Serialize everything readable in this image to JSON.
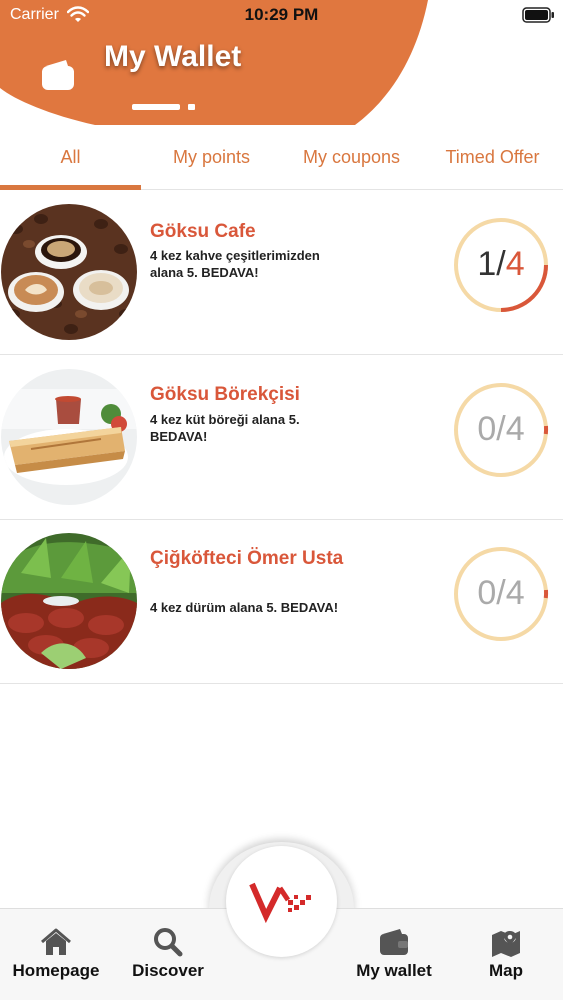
{
  "status_bar": {
    "carrier": "Carrier",
    "time": "10:29 PM"
  },
  "header": {
    "title": "My Wallet",
    "brand_color": "#e0773f"
  },
  "tabs": [
    {
      "label": "All",
      "selected": true
    },
    {
      "label": "My points",
      "selected": false
    },
    {
      "label": "My coupons",
      "selected": false
    },
    {
      "label": "Timed Offer",
      "selected": false
    }
  ],
  "rewards": [
    {
      "name": "Göksu Cafe",
      "description": "4 kez kahve çeşitlerimizden alana 5. BEDAVA!",
      "collected": "1",
      "total": "4",
      "separator": "/",
      "image": "coffee-photo"
    },
    {
      "name": "Göksu Börekçisi",
      "description": "4 kez küt böreği alana 5. BEDAVA!",
      "collected": "0",
      "total": "4",
      "separator": "/",
      "image": "borek-photo"
    },
    {
      "name": "Çiğköfteci Ömer Usta",
      "description": "4 kez dürüm alana 5. BEDAVA!",
      "collected": "0",
      "total": "4",
      "separator": "/",
      "image": "cigkofte-photo"
    }
  ],
  "tab_bar": {
    "items": [
      {
        "label": "Homepage",
        "icon": "home-icon"
      },
      {
        "label": "Discover",
        "icon": "search-icon"
      },
      {
        "label": "My wallet",
        "icon": "wallet-icon"
      },
      {
        "label": "Map",
        "icon": "map-icon"
      }
    ],
    "center_logo": "brand-logo-icon"
  },
  "colors": {
    "accent": "#d9773f",
    "shop_name": "#d9573a",
    "ring_track": "#f5d9a6",
    "ring_fill": "#d9573a"
  }
}
